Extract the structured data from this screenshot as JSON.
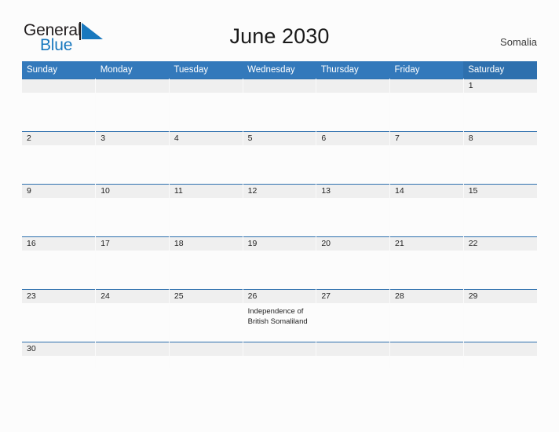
{
  "brand": {
    "name_part1": "General",
    "name_part2": "Blue",
    "sail_icon": "sail-triangle-icon"
  },
  "header": {
    "title": "June 2030",
    "country": "Somalia"
  },
  "colors": {
    "header_blue": "#3379bb",
    "saturday_blue": "#2e70ae",
    "row_line": "#2e70ae",
    "date_band": "#efefef",
    "brand_blue": "#1878be",
    "page_bg": "#fcfcfc"
  },
  "calendar": {
    "weekday_headers": [
      "Sunday",
      "Monday",
      "Tuesday",
      "Wednesday",
      "Thursday",
      "Friday",
      "Saturday"
    ],
    "weeks": [
      [
        {
          "day": "",
          "event": ""
        },
        {
          "day": "",
          "event": ""
        },
        {
          "day": "",
          "event": ""
        },
        {
          "day": "",
          "event": ""
        },
        {
          "day": "",
          "event": ""
        },
        {
          "day": "",
          "event": ""
        },
        {
          "day": "1",
          "event": ""
        }
      ],
      [
        {
          "day": "2",
          "event": ""
        },
        {
          "day": "3",
          "event": ""
        },
        {
          "day": "4",
          "event": ""
        },
        {
          "day": "5",
          "event": ""
        },
        {
          "day": "6",
          "event": ""
        },
        {
          "day": "7",
          "event": ""
        },
        {
          "day": "8",
          "event": ""
        }
      ],
      [
        {
          "day": "9",
          "event": ""
        },
        {
          "day": "10",
          "event": ""
        },
        {
          "day": "11",
          "event": ""
        },
        {
          "day": "12",
          "event": ""
        },
        {
          "day": "13",
          "event": ""
        },
        {
          "day": "14",
          "event": ""
        },
        {
          "day": "15",
          "event": ""
        }
      ],
      [
        {
          "day": "16",
          "event": ""
        },
        {
          "day": "17",
          "event": ""
        },
        {
          "day": "18",
          "event": ""
        },
        {
          "day": "19",
          "event": ""
        },
        {
          "day": "20",
          "event": ""
        },
        {
          "day": "21",
          "event": ""
        },
        {
          "day": "22",
          "event": ""
        }
      ],
      [
        {
          "day": "23",
          "event": ""
        },
        {
          "day": "24",
          "event": ""
        },
        {
          "day": "25",
          "event": ""
        },
        {
          "day": "26",
          "event": "Independence of British Somaliland"
        },
        {
          "day": "27",
          "event": ""
        },
        {
          "day": "28",
          "event": ""
        },
        {
          "day": "29",
          "event": ""
        }
      ],
      [
        {
          "day": "30",
          "event": ""
        },
        {
          "day": "",
          "event": ""
        },
        {
          "day": "",
          "event": ""
        },
        {
          "day": "",
          "event": ""
        },
        {
          "day": "",
          "event": ""
        },
        {
          "day": "",
          "event": ""
        },
        {
          "day": "",
          "event": ""
        }
      ]
    ]
  }
}
